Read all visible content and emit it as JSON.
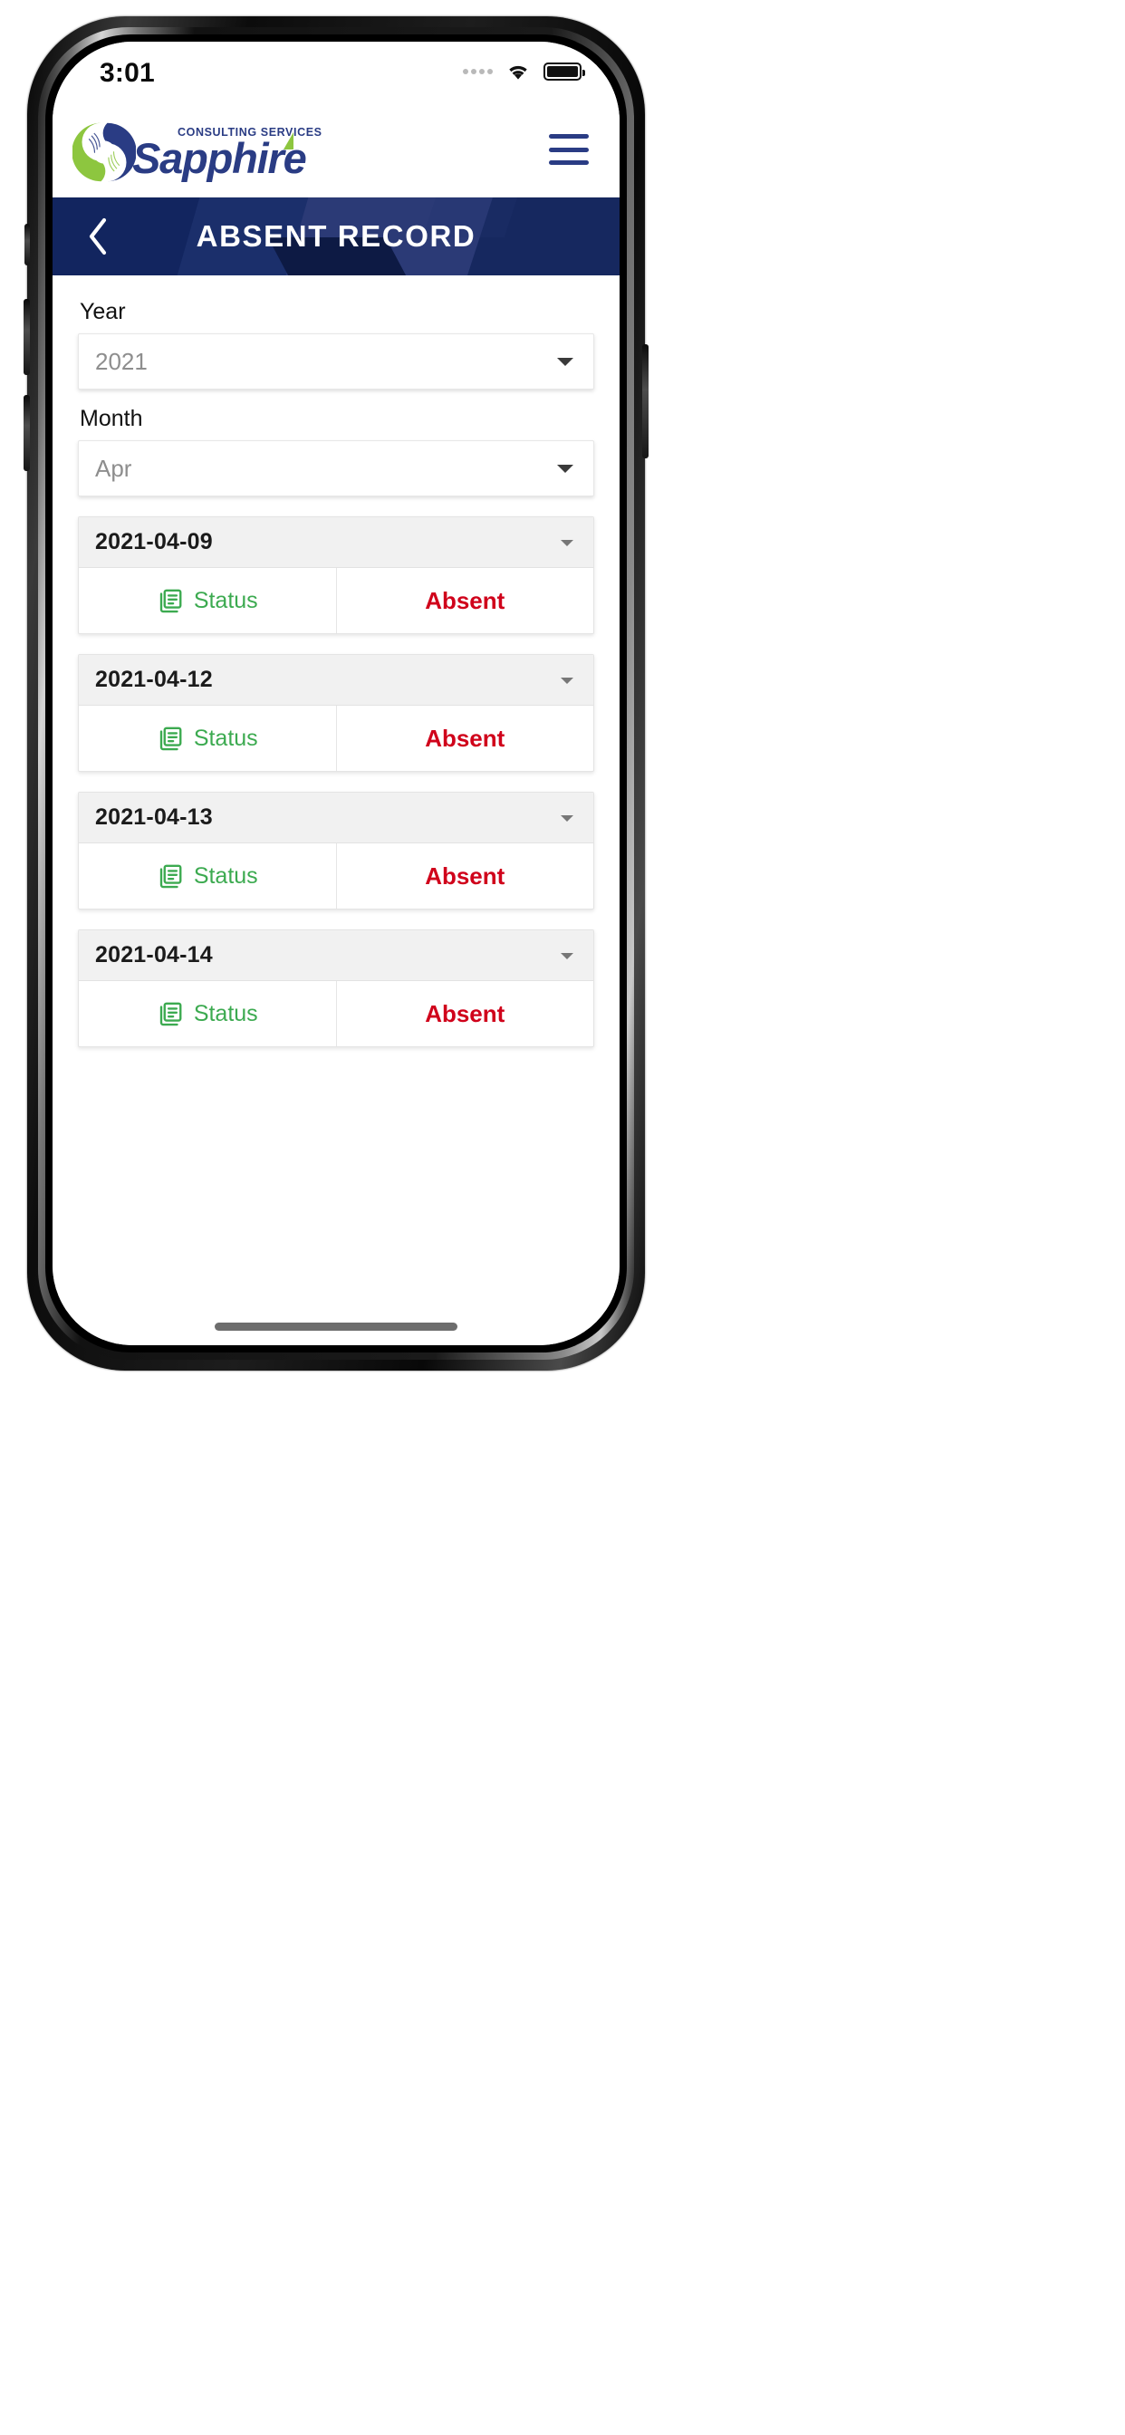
{
  "status_bar": {
    "time": "3:01",
    "signal_icon": "signal-dots-icon",
    "wifi_icon": "wifi-icon",
    "battery_icon": "battery-full-icon"
  },
  "app_bar": {
    "logo_mark": "sapphire-swirl-logo",
    "logo_tagline": "CONSULTING SERVICES",
    "logo_name": "Sapphire",
    "menu_icon": "hamburger-menu-icon",
    "brand_blue": "#2a3c84",
    "brand_green": "#8dc63f"
  },
  "nav_header": {
    "back_icon": "chevron-left-icon",
    "title": "ABSENT RECORD",
    "background": "#2b3a76"
  },
  "filters": {
    "year": {
      "label": "Year",
      "value": "2021",
      "caret_icon": "chevron-down-icon"
    },
    "month": {
      "label": "Month",
      "value": "Apr",
      "caret_icon": "chevron-down-icon"
    }
  },
  "records": {
    "status_icon": "document-list-icon",
    "status_label": "Status",
    "status_color": "#3caa50",
    "absent_color": "#d0021b",
    "items": [
      {
        "date": "2021-04-09",
        "status_label": "Status",
        "value": "Absent",
        "caret_icon": "chevron-down-icon"
      },
      {
        "date": "2021-04-12",
        "status_label": "Status",
        "value": "Absent",
        "caret_icon": "chevron-down-icon"
      },
      {
        "date": "2021-04-13",
        "status_label": "Status",
        "value": "Absent",
        "caret_icon": "chevron-down-icon"
      },
      {
        "date": "2021-04-14",
        "status_label": "Status",
        "value": "Absent",
        "caret_icon": "chevron-down-icon"
      }
    ]
  },
  "home_indicator": "home-indicator-bar"
}
